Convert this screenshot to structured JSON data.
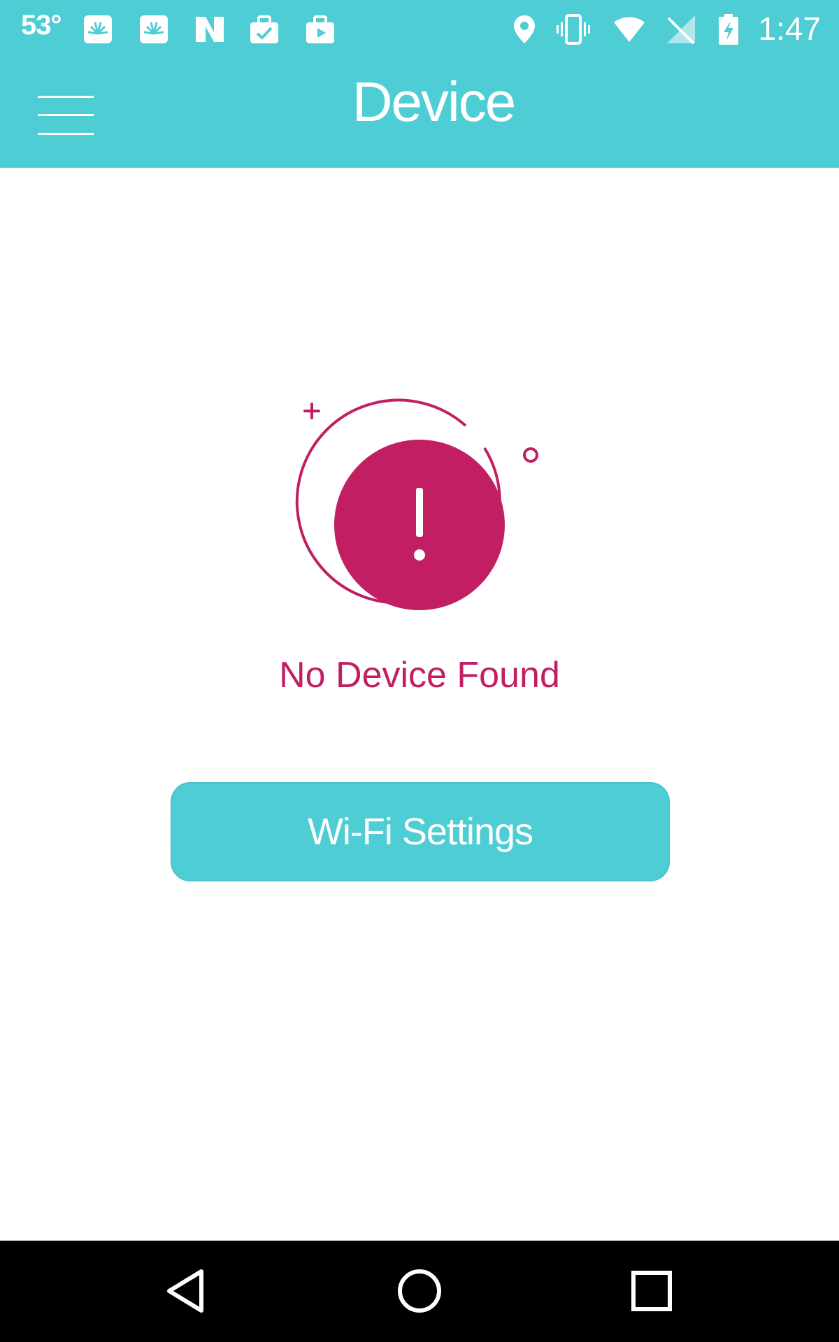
{
  "status_bar": {
    "temperature": "53°",
    "time": "1:47",
    "left_icons": [
      "huawei-icon",
      "huawei-icon",
      "n-logo-icon",
      "briefcase-check-icon",
      "play-store-icon"
    ],
    "right_icons": [
      "location-icon",
      "vibrate-icon",
      "wifi-icon",
      "no-signal-icon",
      "battery-charging-icon"
    ]
  },
  "app_bar": {
    "title": "Device",
    "menu_icon": "hamburger-menu-icon"
  },
  "main": {
    "alert_icon": "exclamation-circle-icon",
    "message": "No Device Found",
    "wifi_button_label": "Wi-Fi Settings"
  },
  "nav_bar": {
    "items": [
      "back-icon",
      "home-icon",
      "recents-icon"
    ]
  },
  "colors": {
    "primary": "#4ecdd4",
    "accent": "#c11e63",
    "background": "#ffffff",
    "nav_background": "#000000"
  }
}
